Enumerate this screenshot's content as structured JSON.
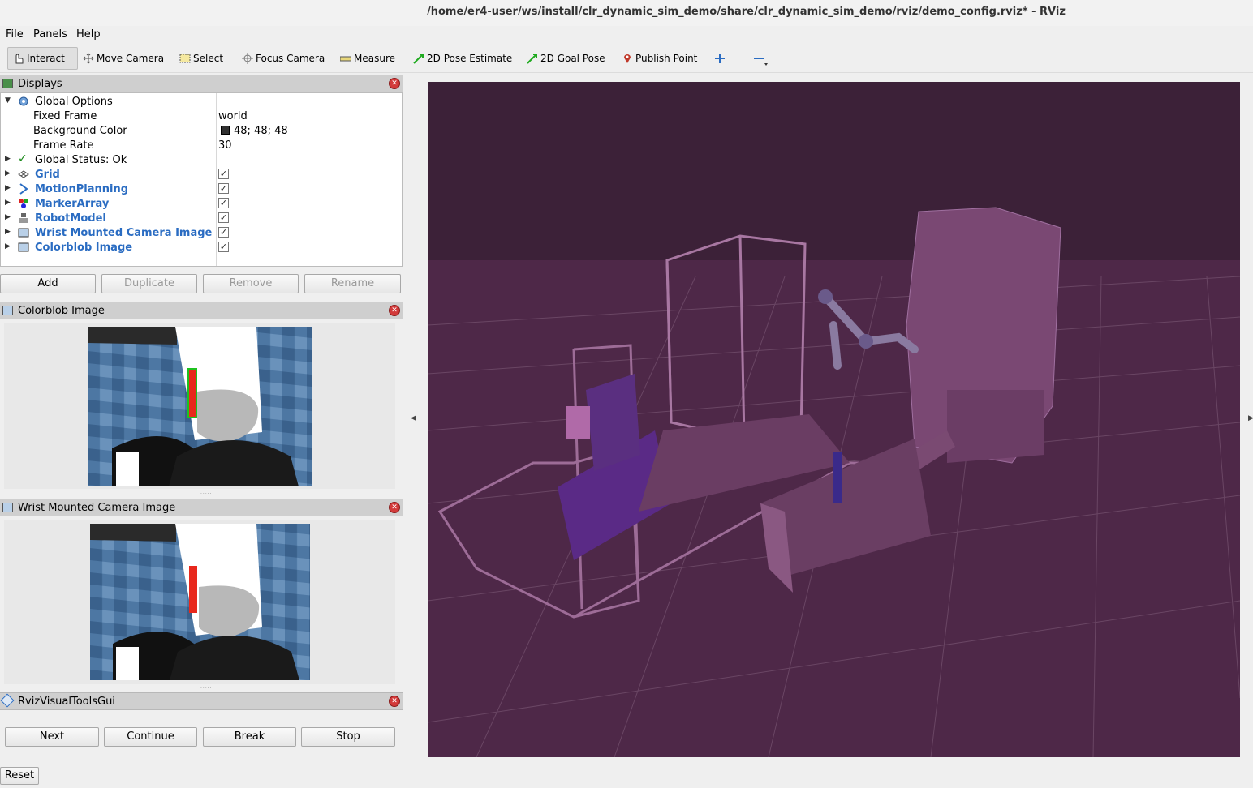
{
  "window": {
    "title": "/home/er4-user/ws/install/clr_dynamic_sim_demo/share/clr_dynamic_sim_demo/rviz/demo_config.rviz* - RViz"
  },
  "menu": {
    "file": "File",
    "panels": "Panels",
    "help": "Help"
  },
  "toolbar": {
    "interact": "Interact",
    "move_camera": "Move Camera",
    "select": "Select",
    "focus_camera": "Focus Camera",
    "measure": "Measure",
    "pose_estimate": "2D Pose Estimate",
    "goal_pose": "2D Goal Pose",
    "publish_point": "Publish Point"
  },
  "displays": {
    "title": "Displays",
    "global_options": "Global Options",
    "fixed_frame_label": "Fixed Frame",
    "fixed_frame_value": "world",
    "bg_color_label": "Background Color",
    "bg_color_value": "48; 48; 48",
    "frame_rate_label": "Frame Rate",
    "frame_rate_value": "30",
    "global_status": "Global Status: Ok",
    "items": [
      "Grid",
      "MotionPlanning",
      "MarkerArray",
      "RobotModel",
      "Wrist Mounted Camera Image",
      "Colorblob Image"
    ],
    "buttons": {
      "add": "Add",
      "duplicate": "Duplicate",
      "remove": "Remove",
      "rename": "Rename"
    }
  },
  "colorblob_panel": {
    "title": "Colorblob Image"
  },
  "wrist_panel": {
    "title": "Wrist Mounted Camera Image"
  },
  "rvt_panel": {
    "title": "RvizVisualToolsGui",
    "next": "Next",
    "continue": "Continue",
    "break": "Break",
    "stop": "Stop"
  },
  "reset": "Reset",
  "colors": {
    "viewport_bg": "#4e2848",
    "link_blue": "#2a6cc2",
    "close_red": "#d23a3a",
    "bg_swatch": "#303030"
  }
}
